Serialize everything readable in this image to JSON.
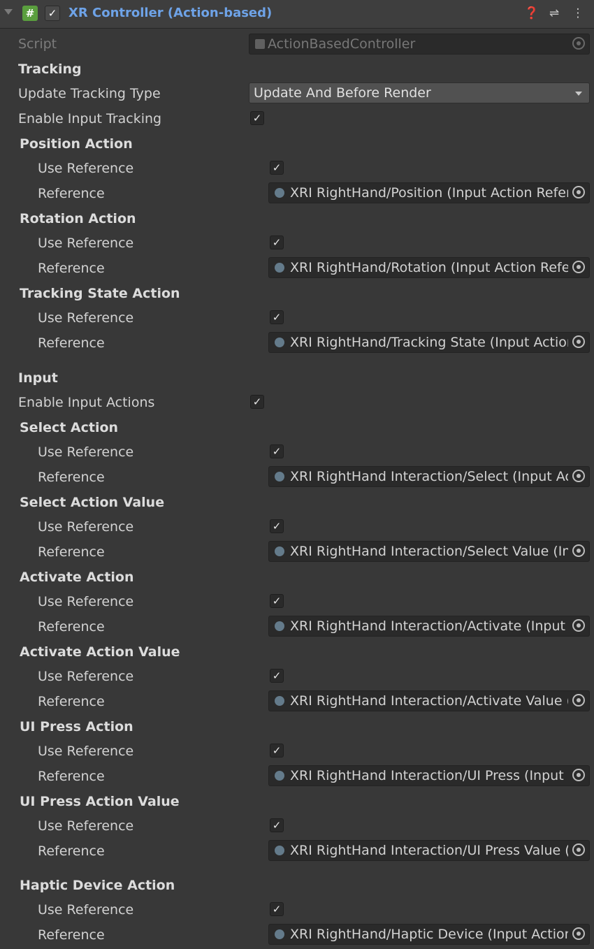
{
  "component": {
    "title": "XR Controller (Action-based)",
    "icons": [
      "foldout-arrow",
      "script-icon",
      "enabled-checkbox",
      "help-icon",
      "presets-icon",
      "menu-icon"
    ]
  },
  "script": {
    "label": "Script",
    "value": "ActionBasedController"
  },
  "tracking": {
    "header": "Tracking",
    "update_tracking_type": {
      "label": "Update Tracking Type",
      "value": "Update And Before Render"
    },
    "enable_input_tracking": {
      "label": "Enable Input Tracking",
      "checked": true
    }
  },
  "input": {
    "header": "Input",
    "enable_input_actions": {
      "label": "Enable Input Actions",
      "checked": true
    }
  },
  "actions": [
    {
      "title": "Position Action",
      "use_reference_label": "Use Reference",
      "use_reference": true,
      "reference_label": "Reference",
      "reference": "XRI RightHand/Position (Input Action Reference)"
    },
    {
      "title": "Rotation Action",
      "use_reference_label": "Use Reference",
      "use_reference": true,
      "reference_label": "Reference",
      "reference": "XRI RightHand/Rotation (Input Action Reference)"
    },
    {
      "title": "Tracking State Action",
      "use_reference_label": "Use Reference",
      "use_reference": true,
      "reference_label": "Reference",
      "reference": "XRI RightHand/Tracking State (Input Action Reference)"
    },
    {
      "title": "Select Action",
      "use_reference_label": "Use Reference",
      "use_reference": true,
      "reference_label": "Reference",
      "reference": "XRI RightHand Interaction/Select (Input Action Reference)"
    },
    {
      "title": "Select Action Value",
      "use_reference_label": "Use Reference",
      "use_reference": true,
      "reference_label": "Reference",
      "reference": "XRI RightHand Interaction/Select Value (Input Action Reference)"
    },
    {
      "title": "Activate Action",
      "use_reference_label": "Use Reference",
      "use_reference": true,
      "reference_label": "Reference",
      "reference": "XRI RightHand Interaction/Activate (Input Action Reference)"
    },
    {
      "title": "Activate Action Value",
      "use_reference_label": "Use Reference",
      "use_reference": true,
      "reference_label": "Reference",
      "reference": "XRI RightHand Interaction/Activate Value (Input Action Reference)"
    },
    {
      "title": "UI Press Action",
      "use_reference_label": "Use Reference",
      "use_reference": true,
      "reference_label": "Reference",
      "reference": "XRI RightHand Interaction/UI Press (Input Action Reference)"
    },
    {
      "title": "UI Press Action Value",
      "use_reference_label": "Use Reference",
      "use_reference": true,
      "reference_label": "Reference",
      "reference": "XRI RightHand Interaction/UI Press Value (Input Action Reference)"
    },
    {
      "title": "Haptic Device Action",
      "use_reference_label": "Use Reference",
      "use_reference": true,
      "reference_label": "Reference",
      "reference": "XRI RightHand/Haptic Device (Input Action Reference)"
    }
  ],
  "colors": {
    "background": "#383838",
    "title_link": "#6ea3e8",
    "field_bg": "#2a2a2a"
  }
}
